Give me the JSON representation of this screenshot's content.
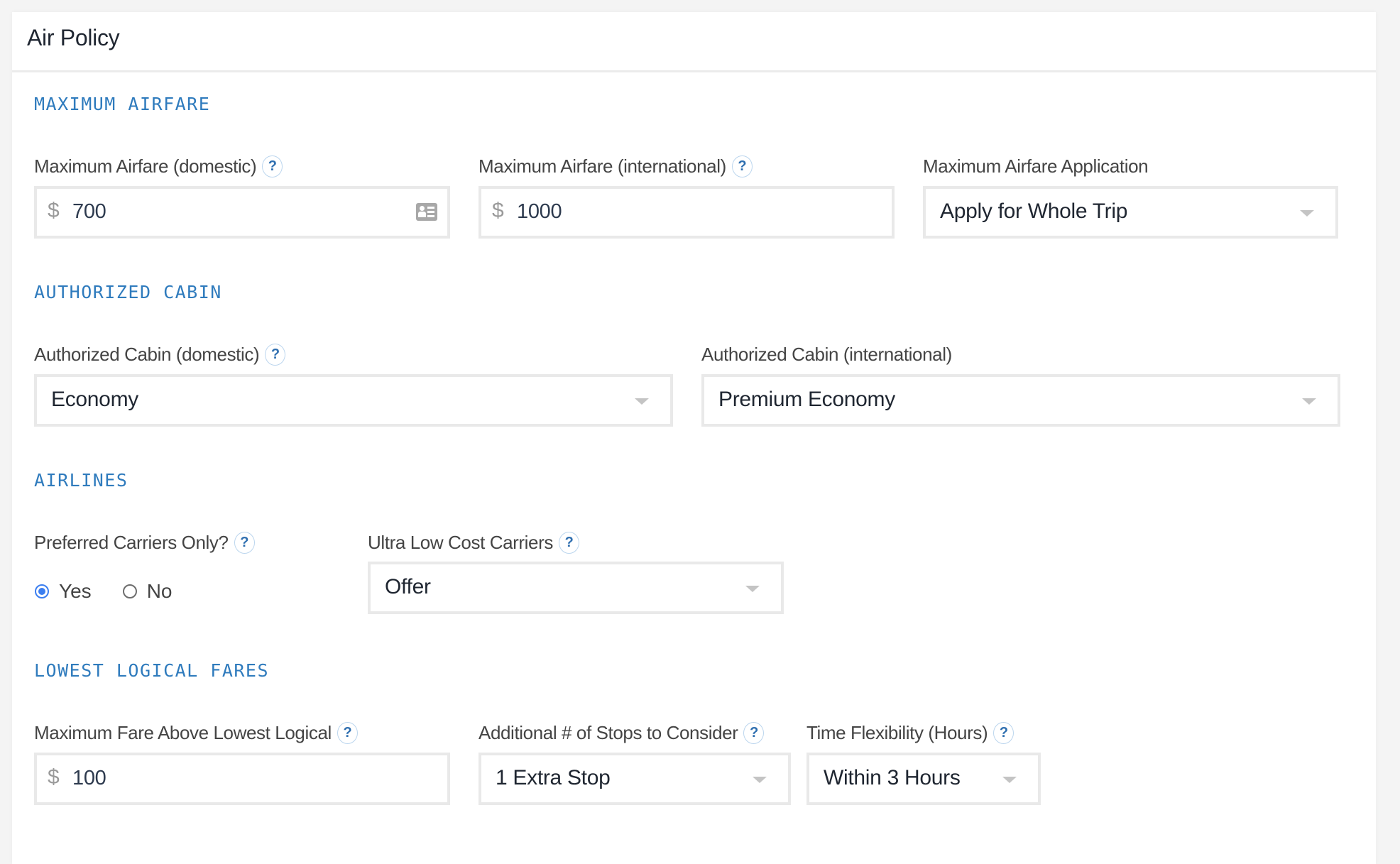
{
  "header": {
    "title": "Air Policy"
  },
  "sections": {
    "max_airfare": {
      "title": "MAXIMUM AIRFARE",
      "domestic": {
        "label": "Maximum Airfare (domestic)",
        "currency": "$",
        "value": "700",
        "help": "?"
      },
      "international": {
        "label": "Maximum Airfare (international)",
        "currency": "$",
        "value": "1000",
        "help": "?"
      },
      "application": {
        "label": "Maximum Airfare Application",
        "value": "Apply for Whole Trip"
      }
    },
    "authorized_cabin": {
      "title": "AUTHORIZED CABIN",
      "domestic": {
        "label": "Authorized Cabin (domestic)",
        "value": "Economy",
        "help": "?"
      },
      "international": {
        "label": "Authorized Cabin (international)",
        "value": "Premium Economy"
      }
    },
    "airlines": {
      "title": "AIRLINES",
      "preferred": {
        "label": "Preferred Carriers Only?",
        "help": "?",
        "options": [
          {
            "label": "Yes",
            "checked": true
          },
          {
            "label": "No",
            "checked": false
          }
        ]
      },
      "ultra_low_cost": {
        "label": "Ultra Low Cost Carriers",
        "value": "Offer",
        "help": "?"
      }
    },
    "lowest_logical": {
      "title": "LOWEST LOGICAL FARES",
      "max_fare_above": {
        "label": "Maximum Fare Above Lowest Logical",
        "currency": "$",
        "value": "100",
        "help": "?"
      },
      "additional_stops": {
        "label": "Additional # of Stops to Consider",
        "value": "1 Extra Stop",
        "help": "?"
      },
      "time_flexibility": {
        "label": "Time Flexibility (Hours)",
        "value": "Within 3 Hours",
        "help": "?"
      }
    }
  },
  "colors": {
    "section_title": "#2f7bbd",
    "radio_selected": "#3b7ef0",
    "input_border": "#e9e9e9"
  }
}
